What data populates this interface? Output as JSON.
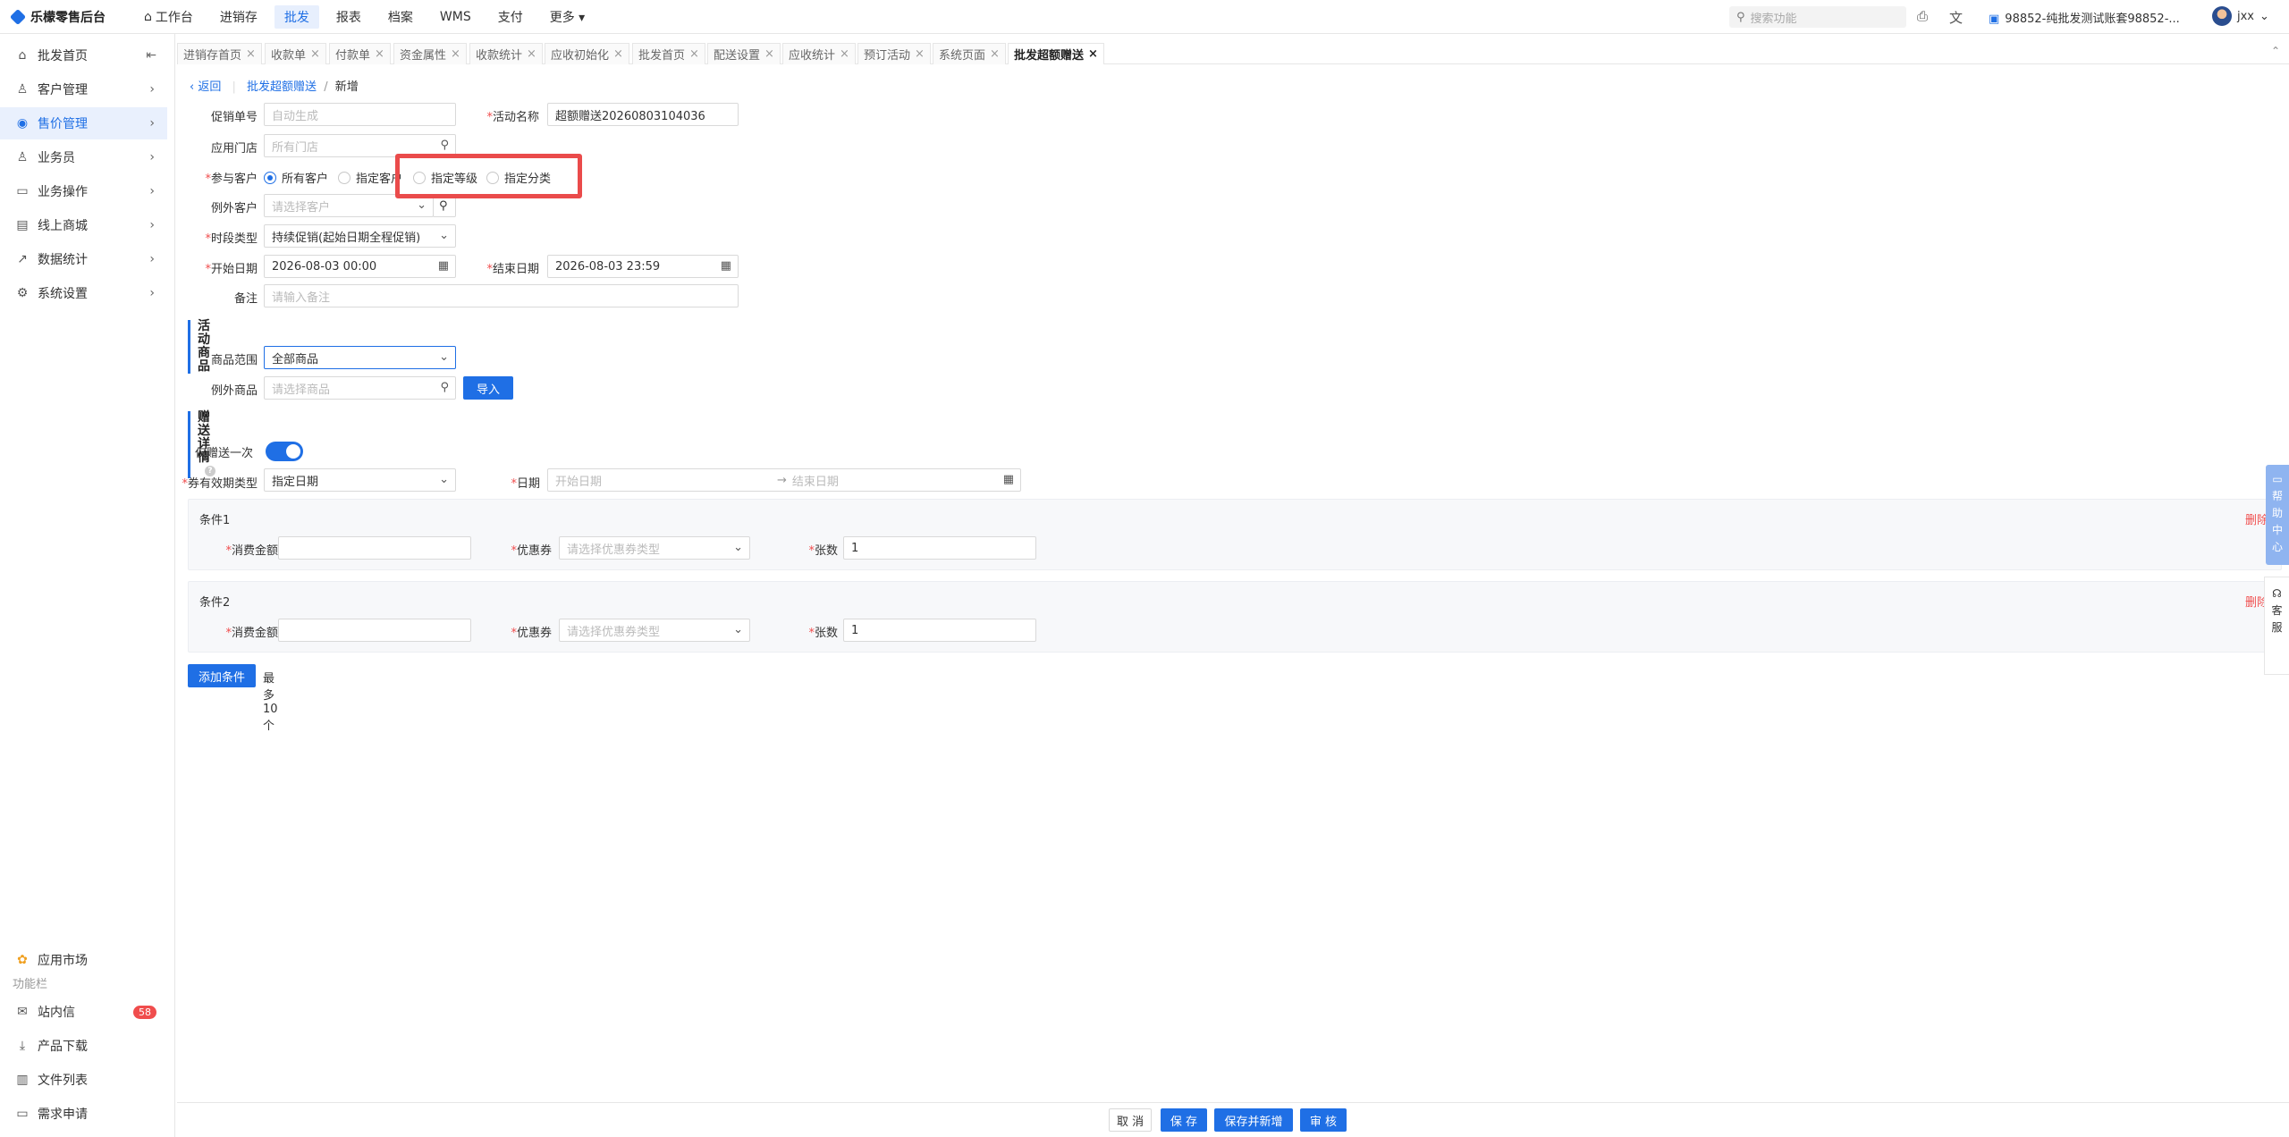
{
  "app": {
    "title": "乐檬零售后台"
  },
  "topnav": [
    "工作台",
    "进销存",
    "批发",
    "报表",
    "档案",
    "WMS",
    "支付",
    "更多"
  ],
  "search": {
    "placeholder": "搜索功能"
  },
  "account": "98852-纯批发测试账套98852-...",
  "user": "jxx",
  "sidebar": {
    "items": [
      "批发首页",
      "客户管理",
      "售价管理",
      "业务员",
      "业务操作",
      "线上商城",
      "数据统计",
      "系统设置"
    ],
    "app_market": "应用市场",
    "section": "功能栏",
    "bottom": [
      "站内信",
      "产品下载",
      "文件列表",
      "需求申请"
    ],
    "badge": "58"
  },
  "tabs": [
    "进销存首页",
    "收款单",
    "付款单",
    "资金属性",
    "收款统计",
    "应收初始化",
    "批发首页",
    "配送设置",
    "应收统计",
    "预订活动",
    "系统页面",
    "批发超额赠送"
  ],
  "breadcrumb": {
    "back": "返回",
    "parent": "批发超额赠送",
    "sep": "/",
    "current": "新增"
  },
  "form": {
    "promo_no": {
      "label": "促销单号",
      "placeholder": "自动生成"
    },
    "activity_name": {
      "label": "活动名称",
      "value": "超额赠送20260803104036"
    },
    "store": {
      "label": "应用门店",
      "placeholder": "所有门店"
    },
    "participants": {
      "label": "参与客户",
      "options": [
        "所有客户",
        "指定客户",
        "指定等级",
        "指定分类"
      ]
    },
    "exclude_customer": {
      "label": "例外客户",
      "placeholder": "请选择客户"
    },
    "period_type": {
      "label": "时段类型",
      "value": "持续促销(起始日期全程促销)"
    },
    "start_date": {
      "label": "开始日期",
      "value": "2026-08-03 00:00"
    },
    "end_date": {
      "label": "结束日期",
      "value": "2026-08-03 23:59"
    },
    "remark": {
      "label": "备注",
      "placeholder": "请输入备注"
    }
  },
  "goods": {
    "title": "活动商品",
    "range": {
      "label": "商品范围",
      "value": "全部商品"
    },
    "exclude": {
      "label": "例外商品",
      "placeholder": "请选择商品"
    },
    "import": "导入"
  },
  "gift": {
    "title": "赠送详情",
    "once": {
      "label": "仅赠送一次",
      "on": true
    },
    "validity": {
      "label": "券有效期类型",
      "value": "指定日期"
    },
    "date": {
      "label": "日期",
      "start_placeholder": "开始日期",
      "arrow": "→",
      "end_placeholder": "结束日期"
    }
  },
  "conditions": [
    {
      "title": "条件1",
      "delete": "删除",
      "amount_label": "消费金额",
      "amount": "",
      "coupon_label": "优惠券",
      "coupon_placeholder": "请选择优惠券类型",
      "count_label": "张数",
      "count": "1"
    },
    {
      "title": "条件2",
      "delete": "删除",
      "amount_label": "消费金额",
      "amount": "",
      "coupon_label": "优惠券",
      "coupon_placeholder": "请选择优惠券类型",
      "count_label": "张数",
      "count": "1"
    }
  ],
  "add_condition": "添加条件",
  "max_hint": "最多10个",
  "footer": [
    "取 消",
    "保 存",
    "保存并新增",
    "审 核"
  ],
  "side_help": "帮助中心",
  "side_kf": "客服"
}
